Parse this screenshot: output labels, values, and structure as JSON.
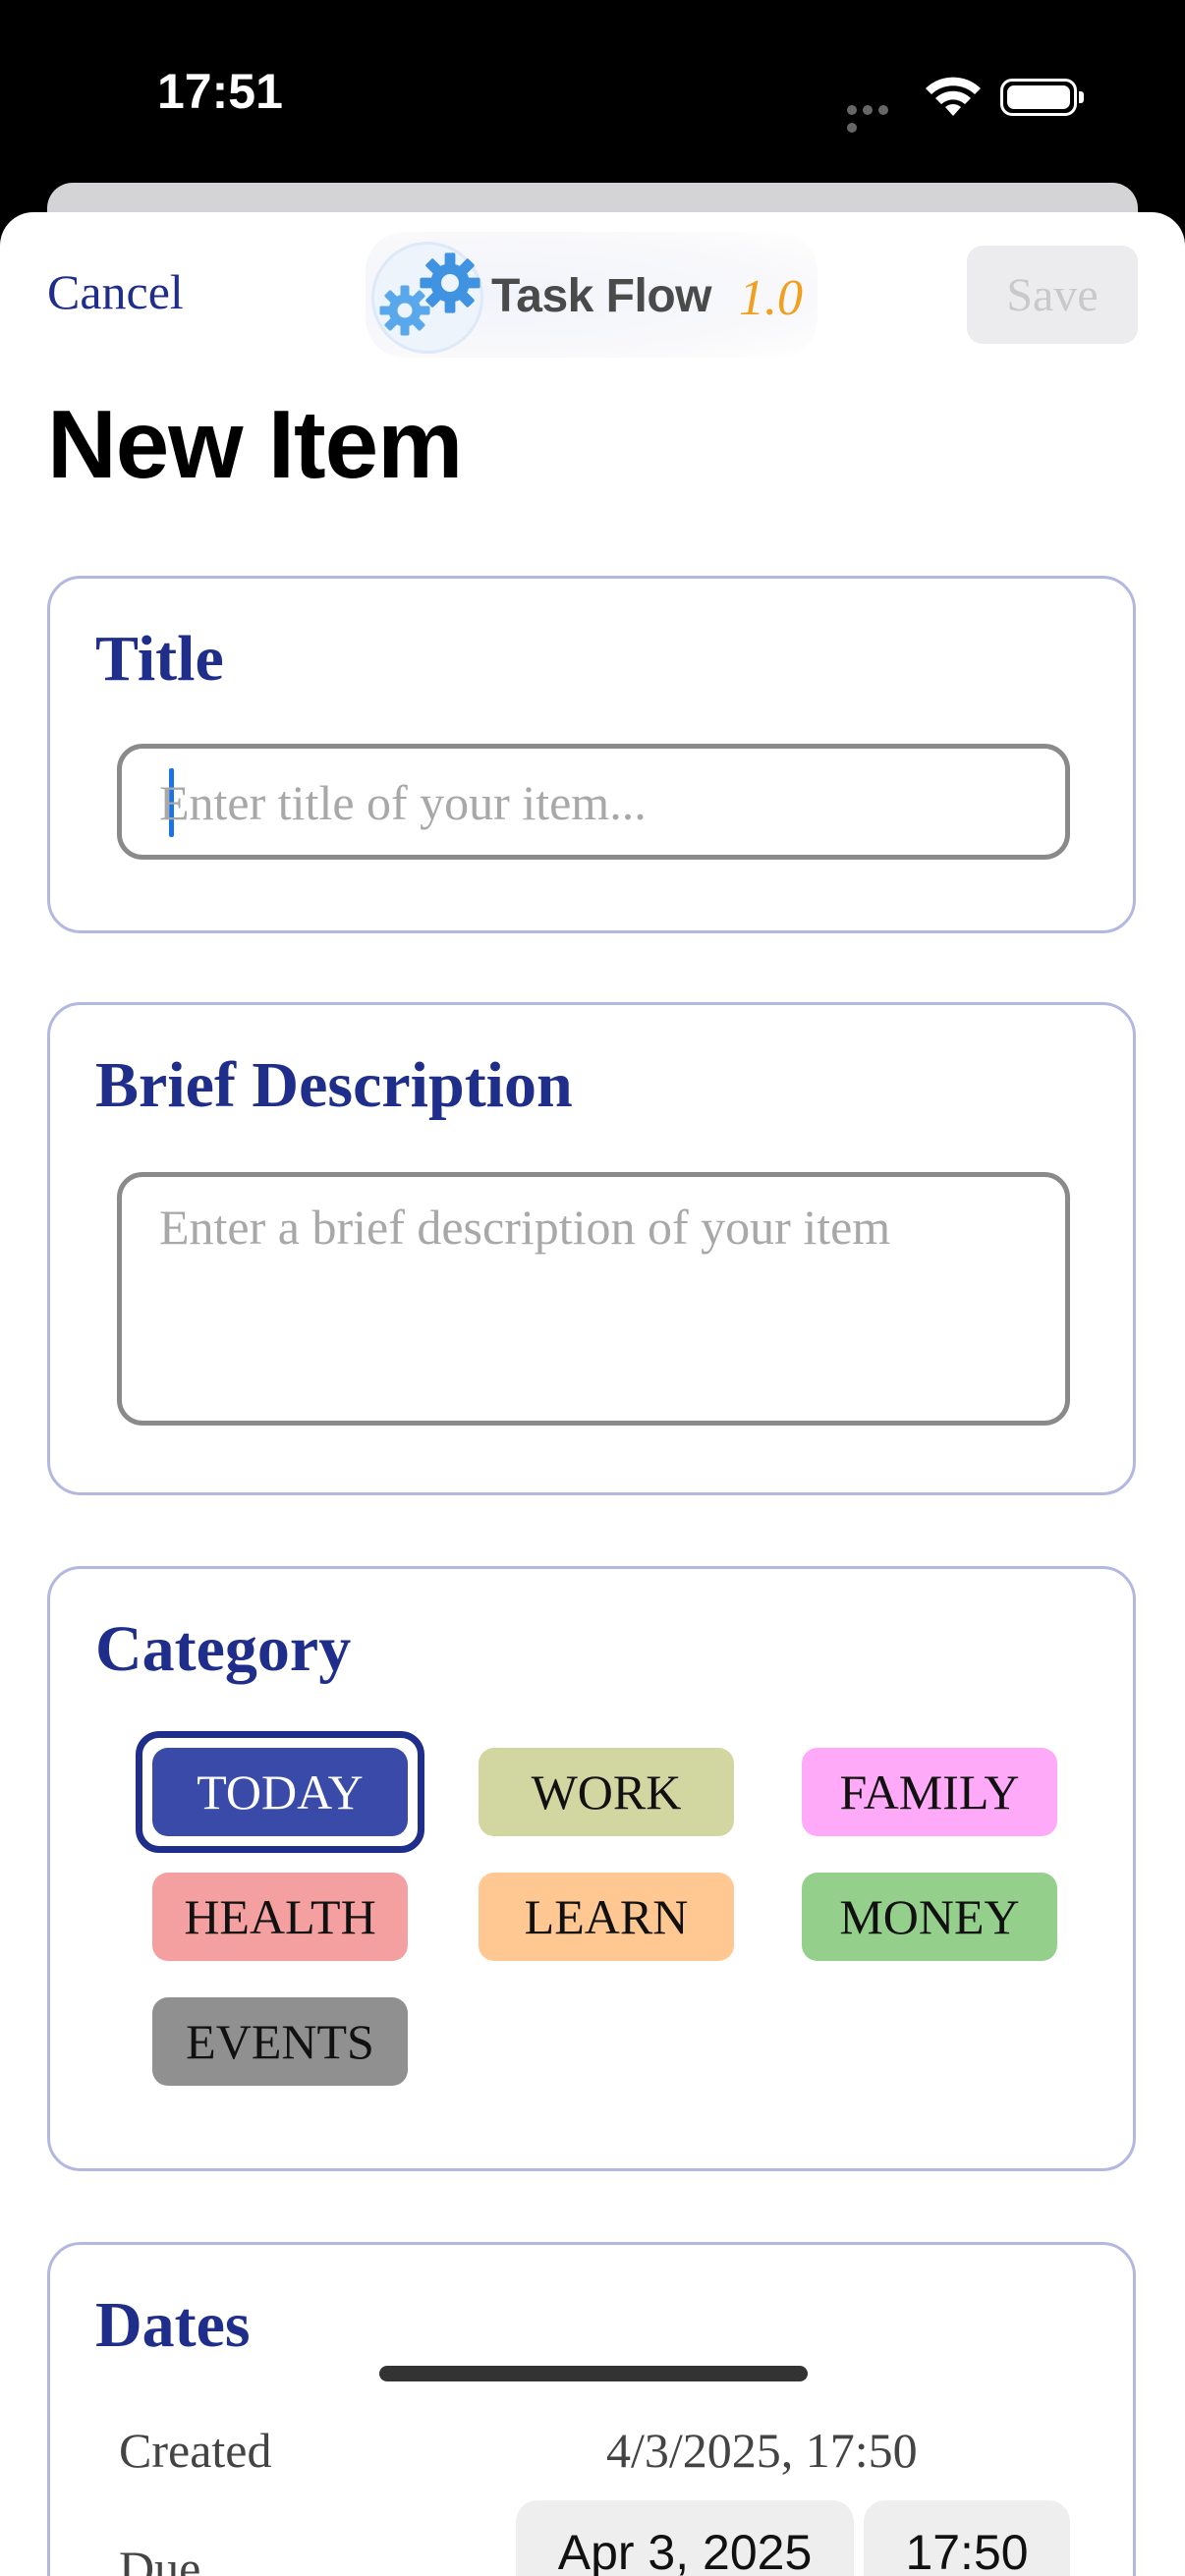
{
  "status_bar": {
    "time": "17:51"
  },
  "nav": {
    "cancel_label": "Cancel",
    "logo_text": "Task Flow",
    "logo_version": "1.0",
    "save_label": "Save"
  },
  "page_title": "New Item",
  "title_section": {
    "heading": "Title",
    "placeholder": "Enter title of your item..."
  },
  "description_section": {
    "heading": "Brief Description",
    "placeholder": "Enter a brief description of your item"
  },
  "category_section": {
    "heading": "Category",
    "selected": "TODAY",
    "chips": [
      {
        "label": "TODAY",
        "color": "#3a4aa8"
      },
      {
        "label": "WORK",
        "color": "#d2d7a2"
      },
      {
        "label": "FAMILY",
        "color": "#ffaaf8"
      },
      {
        "label": "HEALTH",
        "color": "#f4a0a0"
      },
      {
        "label": "LEARN",
        "color": "#ffc792"
      },
      {
        "label": "MONEY",
        "color": "#94d08c"
      },
      {
        "label": "EVENTS",
        "color": "#909090"
      }
    ]
  },
  "dates_section": {
    "heading": "Dates",
    "created_label": "Created",
    "created_value": "4/3/2025, 17:50",
    "due_label": "Due",
    "due_date": "Apr 3, 2025",
    "due_time": "17:50"
  },
  "colors": {
    "accent": "#1f2e8a",
    "card_border": "#b3b8e0",
    "caret": "#1a73e8"
  }
}
